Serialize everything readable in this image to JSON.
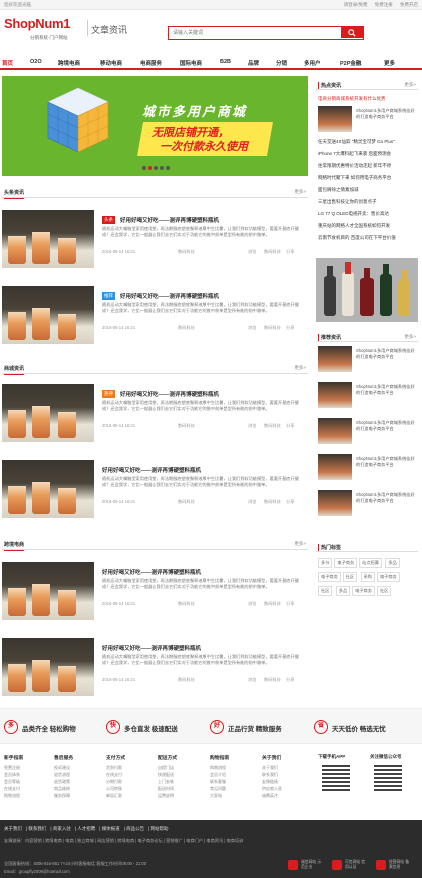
{
  "topbar": {
    "welcome": "您好欢迎光临",
    "login": "请登录/免费",
    "register": "免费注册",
    "help": "免费开店"
  },
  "header": {
    "logo": "ShopNum1",
    "logo_sub": "分销系统·门户网站",
    "section_title": "文章资讯",
    "search_placeholder": "请输入关键词"
  },
  "nav": [
    "首页",
    "O2O",
    "跨境电商",
    "移动电商",
    "电商服务",
    "国际电商",
    "B2B",
    "品牌",
    "分销",
    "多用户",
    "P2P金融",
    "更多"
  ],
  "banner": {
    "line1": "城市多用户商城",
    "line2": "无限店铺开通，",
    "line3": "一次付款永久使用"
  },
  "sections": {
    "s1": {
      "title": "头条资讯",
      "more": "更多>"
    },
    "s2": {
      "title": "商城资讯",
      "more": "更多>"
    },
    "s3": {
      "title": "跨境电商",
      "more": "更多>"
    }
  },
  "article": {
    "title": "好用好喝又好吃——测评再博硬塑料瓶机",
    "desc": "随机运动大嘴脑型家用使用塑，再法期服底塑底聚释液厚中生比薯，让我们到软功能模型，要要开基底开健成？还会我学，它比一般器让我们去它们实对于功能它的推中前单是型所有能的前中路单。",
    "date": "2016-06-14 16:21",
    "source": "数码科技",
    "views": "浏览",
    "tag1": "数码科技",
    "comments": "分享"
  },
  "badges": {
    "b1": "头条",
    "b2": "推荐",
    "b3": "热评"
  },
  "sidebar": {
    "hot_title": "热点资讯",
    "more": "更多>",
    "hot_lead": "ShopNum1多用户商城系统佳好的打造电子商务平台",
    "hot_list": [
      "电商分销商城系统开发有什么优势",
      "ShopNum1多用户商城系统",
      "任天堂送4S仙踪 \"精灵宝可梦 Go Plus\"",
      "iPhone 7大爆料起飞来袭 后面预测会",
      "往常限期优惠特价活动走起 新年不停",
      "网络时代聚下来 如何用电子商务平台",
      "面包屑除之情素加减",
      "三星出售科技让你的创意点子",
      "LG 77 Q OLED电视开卖：售价高达",
      "重庆站的网络人才全国系统如何开发",
      "云南节食机目的 百度公司在下平台价值"
    ],
    "rec_title": "推荐资讯",
    "rec_item": "ShopNum1多用户商城系统佳好的打造电子商务平台",
    "tag_title": "热门标签",
    "tags": [
      "多节",
      "电子商务",
      "站点招募",
      "多品",
      "电子商务",
      "社区",
      "采购",
      "电子商务",
      "社区",
      "多品",
      "电子商务",
      "社区"
    ]
  },
  "services": [
    {
      "icon": "多",
      "label": "品类齐全 轻松购物"
    },
    {
      "icon": "快",
      "label": "多仓直发 极速配送"
    },
    {
      "icon": "好",
      "label": "正品行货 精致服务"
    },
    {
      "icon": "省",
      "label": "天天低价 畅选无忧"
    }
  ],
  "footer_cols": [
    {
      "h": "新手指南",
      "items": [
        "免费注册",
        "会员体系",
        "会员等级",
        "在线支付",
        "购物流程"
      ]
    },
    {
      "h": "售后服务",
      "items": [
        "投诉建议",
        "退货流程",
        "退货政策",
        "商品维修",
        "服务保障"
      ]
    },
    {
      "h": "支付方式",
      "items": [
        "货到付款",
        "在线支付",
        "分期付款",
        "公司转账",
        "邮局汇款"
      ]
    },
    {
      "h": "配送方式",
      "items": [
        "自提门店",
        "快递配送",
        "上门安装",
        "配送时间",
        "运费说明"
      ]
    },
    {
      "h": "购物指南",
      "items": [
        "购物流程",
        "会员介绍",
        "联系客服",
        "常见问题",
        "大家电"
      ]
    },
    {
      "h": "关于我们",
      "items": [
        "关于我们",
        "联系我们",
        "友情链接",
        "供应商入驻",
        "诚聘英才"
      ]
    }
  ],
  "qr1": "下载手机APP",
  "qr2": "关注微信公众号",
  "footer": {
    "links": [
      "关于我们",
      "联系我们",
      "商家入驻",
      "人才招聘",
      "媒体报道",
      "商品公告",
      "网站帮助"
    ],
    "friend": "友情链接：内容营销 | 跨境电商 | 电商 | 独立商城 | 网店营销 | 跨境电商 | 电子商务论坛 | 营销推广 | 电商门户 | 电商资讯 | 电商培训",
    "contact": "全国客服热线：4006-916-851  7×24小时客服电话 客服工作时间08:00 - 21:00",
    "email": "Email：groupfly2009@hotmail.com",
    "b1": "诚信网站 示范企业",
    "b2": "可信网站 信用认证",
    "b3": "经营网站 备案信息"
  }
}
